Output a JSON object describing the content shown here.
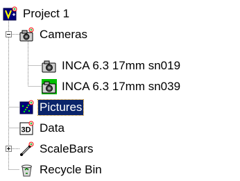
{
  "tree": {
    "root": {
      "label": "Project 1",
      "icon": "project-icon"
    },
    "cameras": {
      "label": "Cameras",
      "icon": "cameras-folder-icon",
      "expanded": true,
      "items": [
        {
          "label": "INCA 6.3 17mm sn019",
          "icon": "camera-icon"
        },
        {
          "label": "INCA 6.3 17mm sn039",
          "icon": "camera-icon"
        }
      ]
    },
    "pictures": {
      "label": "Pictures",
      "icon": "pictures-icon",
      "selected": true
    },
    "data": {
      "label": "Data",
      "icon": "3d-data-icon"
    },
    "scalebars": {
      "label": "ScaleBars",
      "icon": "scalebar-icon",
      "expanded": false
    },
    "recycle": {
      "label": "Recycle Bin",
      "icon": "recycle-bin-icon"
    }
  },
  "colors": {
    "selection": "#0a246a",
    "tree_lines": "#808080"
  }
}
